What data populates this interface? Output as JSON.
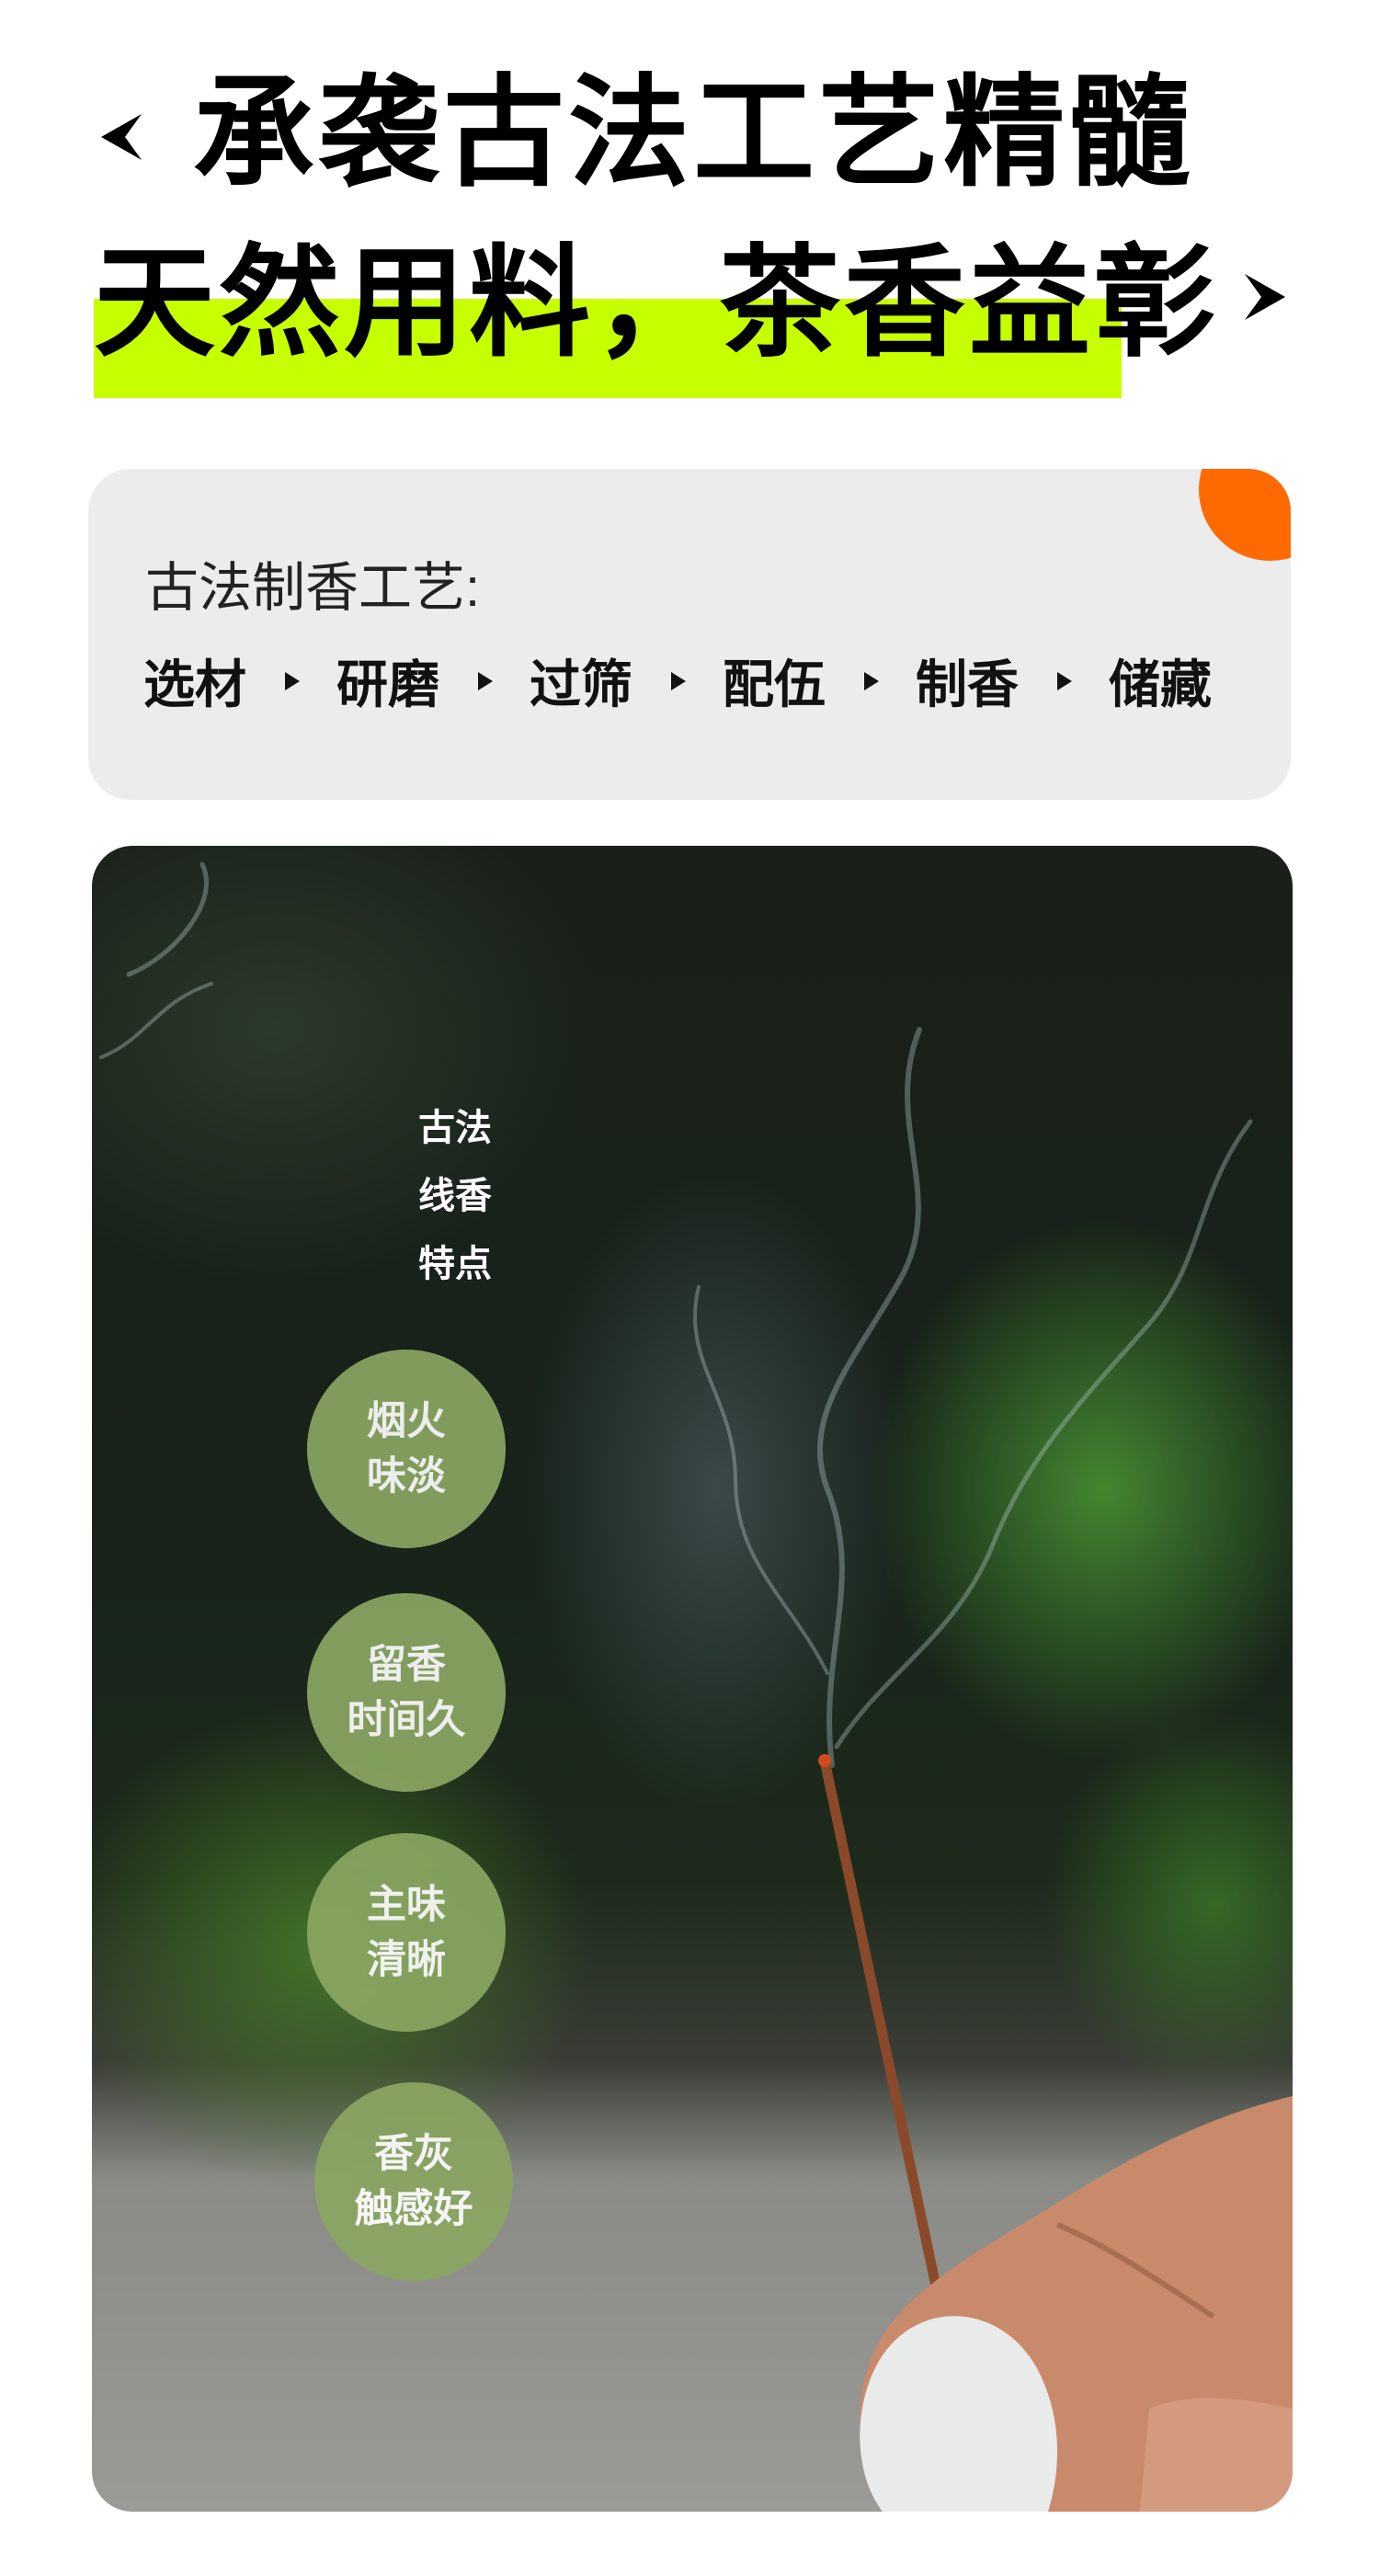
{
  "header": {
    "line1": "承袭古法工艺精髓",
    "line2": "天然用料，茶香益彰",
    "highlight_color": "#c6ff00",
    "left_icon": "chevron-left-icon",
    "right_icon": "chevron-right-icon"
  },
  "process": {
    "title": "古法制香工艺:",
    "steps": [
      "选材",
      "研磨",
      "过筛",
      "配伍",
      "制香",
      "储藏"
    ],
    "step_separator_icon": "triangle-right-icon",
    "accent_color": "#ff6a00",
    "card_color": "#ececec"
  },
  "photo": {
    "subject": "incense-stick-photo",
    "features_title": [
      "古法",
      "线香",
      "特点"
    ],
    "features": [
      {
        "line1": "烟火",
        "line2": "味淡"
      },
      {
        "line1": "留香",
        "line2": "时间久"
      },
      {
        "line1": "主味",
        "line2": "清晰"
      },
      {
        "line1": "香灰",
        "line2": "触感好"
      }
    ],
    "bubble_color": "#8aa662"
  }
}
